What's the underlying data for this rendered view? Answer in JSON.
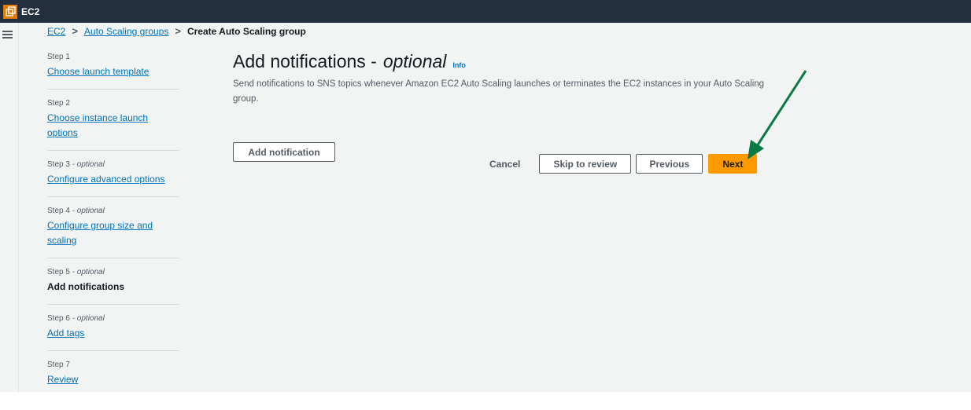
{
  "topbar": {
    "service_name": "EC2",
    "service_icon": "ec2-service-icon"
  },
  "leftrail": {
    "menu_icon": "hamburger-menu-icon"
  },
  "breadcrumb": {
    "items": [
      "EC2",
      "Auto Scaling groups"
    ],
    "current": "Create Auto Scaling group",
    "separator": ">"
  },
  "steps": [
    {
      "number": "Step 1",
      "optional": "",
      "label": "Choose launch template",
      "state": "link"
    },
    {
      "number": "Step 2",
      "optional": "",
      "label": "Choose instance launch options",
      "state": "link"
    },
    {
      "number": "Step 3",
      "optional": "- optional",
      "label": "Configure advanced options",
      "state": "link"
    },
    {
      "number": "Step 4",
      "optional": "- optional",
      "label": "Configure group size and scaling",
      "state": "link"
    },
    {
      "number": "Step 5",
      "optional": "- optional",
      "label": "Add notifications",
      "state": "current"
    },
    {
      "number": "Step 6",
      "optional": "- optional",
      "label": "Add tags",
      "state": "link"
    },
    {
      "number": "Step 7",
      "optional": "",
      "label": "Review",
      "state": "link"
    }
  ],
  "main": {
    "title": "Add notifications -",
    "title_optional": "optional",
    "info_link": "Info",
    "description": "Send notifications to SNS topics whenever Amazon EC2 Auto Scaling launches or terminates the EC2 instances in your Auto Scaling group.",
    "add_notification_label": "Add notification"
  },
  "actions": {
    "cancel_label": "Cancel",
    "skip_label": "Skip to review",
    "previous_label": "Previous",
    "next_label": "Next"
  },
  "annotation": {
    "arrow_color": "#0a7a45",
    "icon": "green-arrow-pointer-icon"
  },
  "colors": {
    "topbar": "#232f3e",
    "link": "#0073bb",
    "primary_button": "#ff9900",
    "service_icon": "#e07b00"
  }
}
